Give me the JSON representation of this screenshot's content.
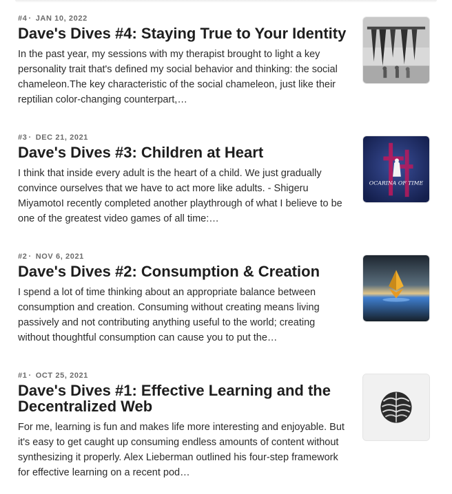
{
  "posts": [
    {
      "number": "#4",
      "date": "JAN 10, 2022",
      "title": "Dave's Dives #4: Staying True to Your Identity",
      "excerpt": "In the past year, my sessions with my therapist brought to light a key personality trait that's defined my social behavior and thinking: the social chameleon.The key characteristic of the social chameleon, just like their reptilian color-changing counterpart,…",
      "thumbnail_icon": "fishing-photo"
    },
    {
      "number": "#3",
      "date": "DEC 21, 2021",
      "title": "Dave's Dives #3: Children at Heart",
      "excerpt": "I think that inside every adult is the heart of a child. We just gradually convince ourselves that we have to act more like adults. - Shigeru MiyamotoI recently completed another playthrough of what I believe to be one of the greatest video games of all time:…",
      "thumbnail_icon": "ocarina-of-time-art",
      "thumbnail_text": "OCARINA OF TIME"
    },
    {
      "number": "#2",
      "date": "NOV 6, 2021",
      "title": "Dave's Dives #2: Consumption & Creation",
      "excerpt": "I spend a lot of time thinking about an appropriate balance between consumption and creation. Consuming without creating means living passively and not contributing anything useful to the world; creating without thoughtful consumption can cause you to put the…",
      "thumbnail_icon": "ethereum-crystal-art"
    },
    {
      "number": "#1",
      "date": "OCT 25, 2021",
      "title": "Dave's Dives #1: Effective Learning and the Decentralized Web",
      "excerpt": "For me, learning is fun and makes life more interesting and enjoyable. But it's easy to get caught up consuming endless amounts of content without synthesizing it properly. Alex Lieberman outlined his four-step framework for effective learning on a recent pod…",
      "thumbnail_icon": "brain-sphere-art"
    }
  ],
  "colors": {
    "meta": "#6b6b6b",
    "title": "#1d1d1d",
    "body": "#2b2b2b",
    "ocarina_bg": "#1c2b66",
    "ocarina_glyph": "#c2185b"
  }
}
